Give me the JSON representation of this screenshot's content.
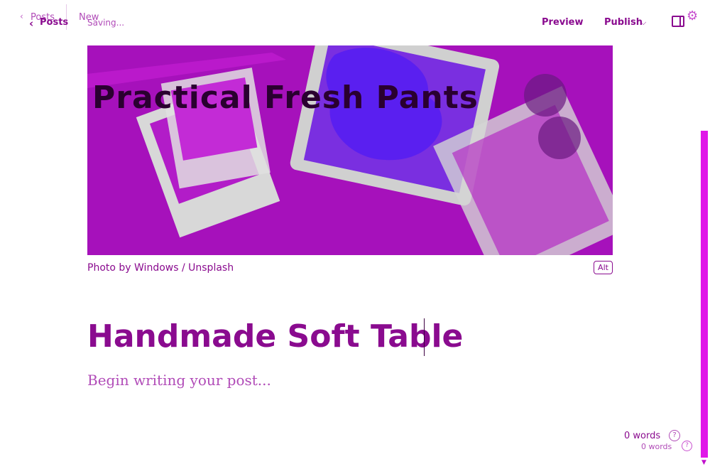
{
  "ghost_header": {
    "back_glyph": "‹",
    "posts_label": "Posts",
    "new_label": "New"
  },
  "header": {
    "back_glyph": "‹",
    "posts_label": "Posts",
    "status": "Saving...",
    "preview_label": "Preview",
    "publish_label": "Publish",
    "publish_chevron": "⌵",
    "settings_icon": "⚙"
  },
  "feature_image": {
    "overlay_title": "Practical Fresh Pants",
    "caption_prefix": "Photo by ",
    "caption_author": "Windows",
    "caption_separator": " / ",
    "caption_source": "Unsplash",
    "alt_label": "Alt"
  },
  "editor": {
    "title": "Handmade Soft Table",
    "body_placeholder": "Begin writing your post..."
  },
  "footer": {
    "word_count_primary": "0 words",
    "word_count_secondary": "0 words",
    "help_glyph": "?"
  },
  "colors": {
    "accent": "#8a0b8f",
    "accent_light": "#b14cb8",
    "scrollbar": "#e017e8"
  }
}
